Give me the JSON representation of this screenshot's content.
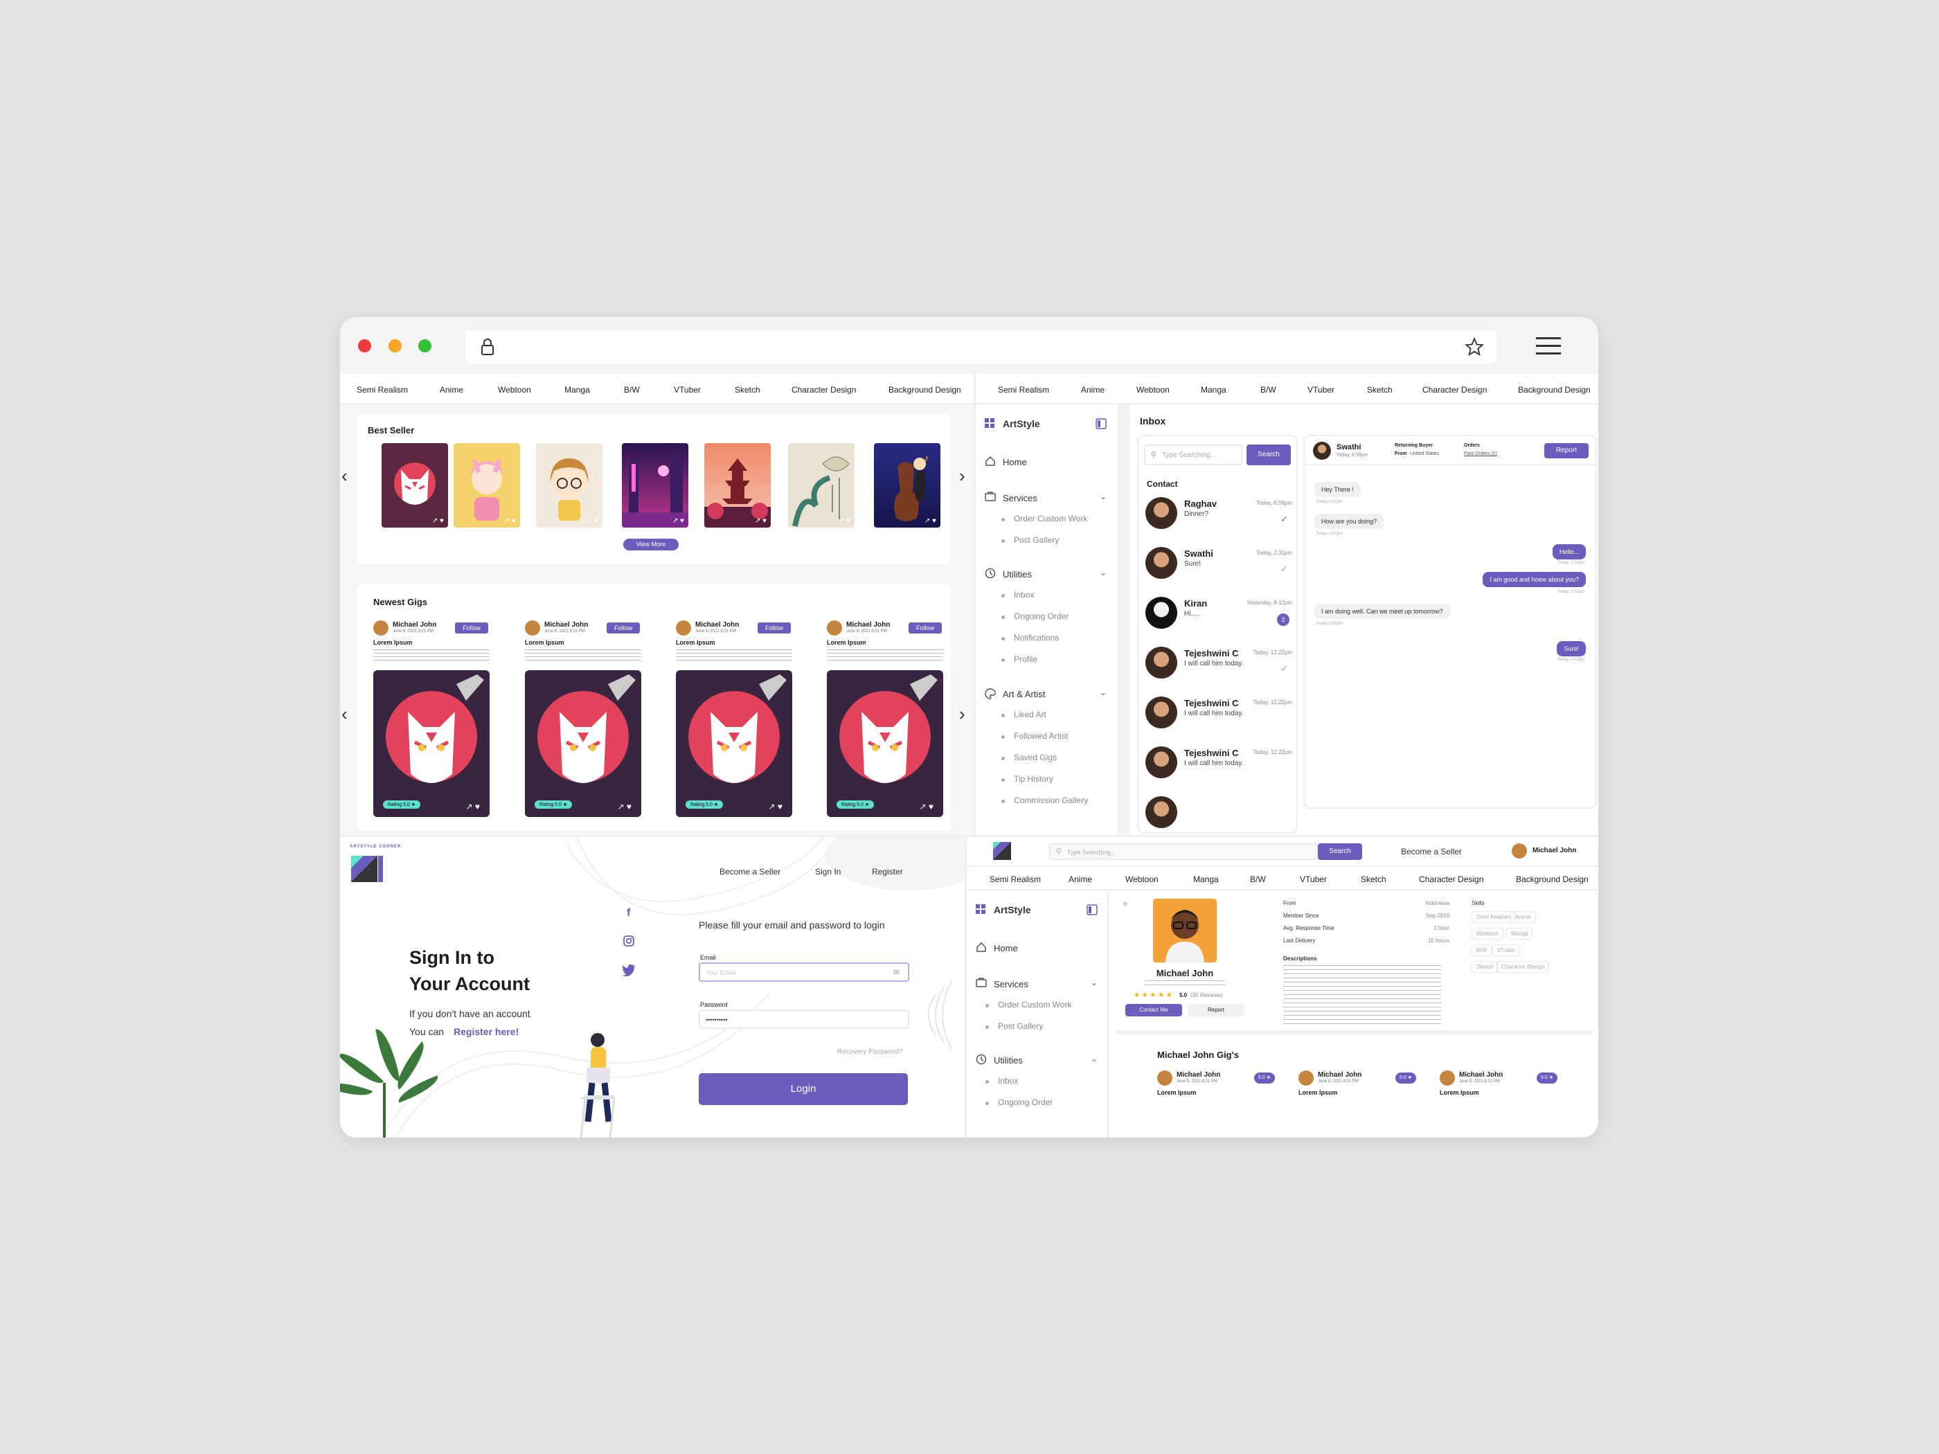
{
  "browser": {
    "url": "",
    "icons": [
      "lock-icon",
      "star-icon",
      "menu-icon"
    ]
  },
  "colors": {
    "accent": "#6b5dbd",
    "mint": "#5de1c9",
    "bg": "#e4e4e4"
  },
  "categories": [
    "Semi Realism",
    "Anime",
    "Webtoon",
    "Manga",
    "B/W",
    "VTuber",
    "Sketch",
    "Character Design",
    "Background Design"
  ],
  "home": {
    "best_seller_title": "Best Seller",
    "view_more": "View More",
    "newest_title": "Newest Gigs",
    "gig": {
      "name": "Michael John",
      "date": "June 8, 2021 8:01 PM",
      "follow": "Follow",
      "title": "Lorem Ipsum",
      "rating": "Rating 5.0 ★"
    }
  },
  "inbox": {
    "app_name": "ArtStyle",
    "title": "Inbox",
    "search_placeholder": "Type Searching...",
    "search_button": "Search",
    "contact_title": "Contact",
    "sidebar": {
      "home": "Home",
      "services": "Services",
      "services_items": [
        "Order Custom Work",
        "Post Gallery"
      ],
      "utilities": "Utilities",
      "utilities_items": [
        "Inbox",
        "Ongoing Order",
        "Notifications",
        "Profile"
      ],
      "art": "Art & Artist",
      "art_items": [
        "Liked Art",
        "Followed Artist",
        "Saved Gigs",
        "Tip History",
        "Commission Gallery"
      ]
    },
    "contacts": [
      {
        "name": "Raghav",
        "msg": "Dinner?",
        "time": "Today, 8:56pm",
        "status": "✓"
      },
      {
        "name": "Swathi",
        "msg": "Sure!",
        "time": "Today, 2:31pm",
        "status": "✓"
      },
      {
        "name": "Kiran",
        "msg": "Hi.....",
        "time": "Yesterday, 8:12pm",
        "status": "2"
      },
      {
        "name": "Tejeshwini C",
        "msg": "I will call him today.",
        "time": "Today, 12:22pm",
        "status": "✓"
      },
      {
        "name": "Tejeshwini C",
        "msg": "I will call him today.",
        "time": "Today, 12:22pm",
        "status": ""
      },
      {
        "name": "Tejeshwini C",
        "msg": "I will call him today.",
        "time": "Today, 12:22pm",
        "status": ""
      }
    ],
    "chat": {
      "name": "Swathi",
      "sub": "Today, 8:56pm",
      "buyer_label": "Returning Buyer",
      "buyer_from": "From",
      "buyer_country": "United States",
      "orders_label": "Orders",
      "orders_link": "Past Orders (2)",
      "report": "Report",
      "messages": [
        {
          "text": "Hey There !",
          "side": "left",
          "time": "Today, 2:01pm"
        },
        {
          "text": "How are you doing?",
          "side": "left",
          "time": "Today, 2:01pm"
        },
        {
          "text": "Hello...",
          "side": "right",
          "time": "Today, 2:01pm"
        },
        {
          "text": "I am good and hoew about you?",
          "side": "right",
          "time": "Today, 2:02pm"
        },
        {
          "text": "I am doing well. Can we meet up tomorrow?",
          "side": "left",
          "time": "Today, 2:03pm"
        },
        {
          "text": "Sure!",
          "side": "right",
          "time": "Today, 2:03pm"
        }
      ]
    }
  },
  "signin": {
    "brand": "ARTSTYLE CORNER",
    "nav": [
      "Become a Seller",
      "Sign In",
      "Register"
    ],
    "title_line1": "Sign In to",
    "title_line2": "Your Account",
    "sub1": "If you don't have an account",
    "sub2": "You can",
    "register_link": "Register here!",
    "prompt": "Please fill your email and password to login",
    "email_label": "Email",
    "email_placeholder": "Your Email",
    "password_label": "Password",
    "password_value": "••••••••••",
    "recovery": "Recovery Password?",
    "login": "Login",
    "social": [
      "facebook-icon",
      "instagram-icon",
      "twitter-icon"
    ]
  },
  "profile": {
    "search_placeholder": "Type Searching...",
    "search_button": "Search",
    "become_seller": "Become a Seller",
    "user": "Michael John",
    "name": "Michael John",
    "rating": "5.0",
    "reviews": "(30 Reviews)",
    "contact": "Contact Me",
    "report": "Report",
    "info": [
      {
        "label": "From",
        "value": "Indonesia"
      },
      {
        "label": "Member Since",
        "value": "Sep 2019"
      },
      {
        "label": "Avg. Response Time",
        "value": "1 hour"
      },
      {
        "label": "Last Delivery",
        "value": "10 hours"
      }
    ],
    "description_label": "Descriptions",
    "skills_label": "Skills",
    "skills": [
      "Semi Realism",
      "Anime",
      "Webtoon",
      "Manga",
      "B/W",
      "VTuber",
      "Sketch",
      "Character Design"
    ],
    "gigs_title": "Michael John Gig's",
    "gig_name": "Michael John",
    "gig_date": "June 8, 2021 8:01 PM",
    "gig_rating": "5.0 ★",
    "gig_title": "Lorem Ipsum",
    "sidebar": {
      "app_name": "ArtStyle",
      "home": "Home",
      "services": "Services",
      "services_items": [
        "Order Custom Work",
        "Post Gallery"
      ],
      "utilities": "Utilities",
      "utilities_items": [
        "Inbox",
        "Ongoing Order"
      ]
    }
  }
}
